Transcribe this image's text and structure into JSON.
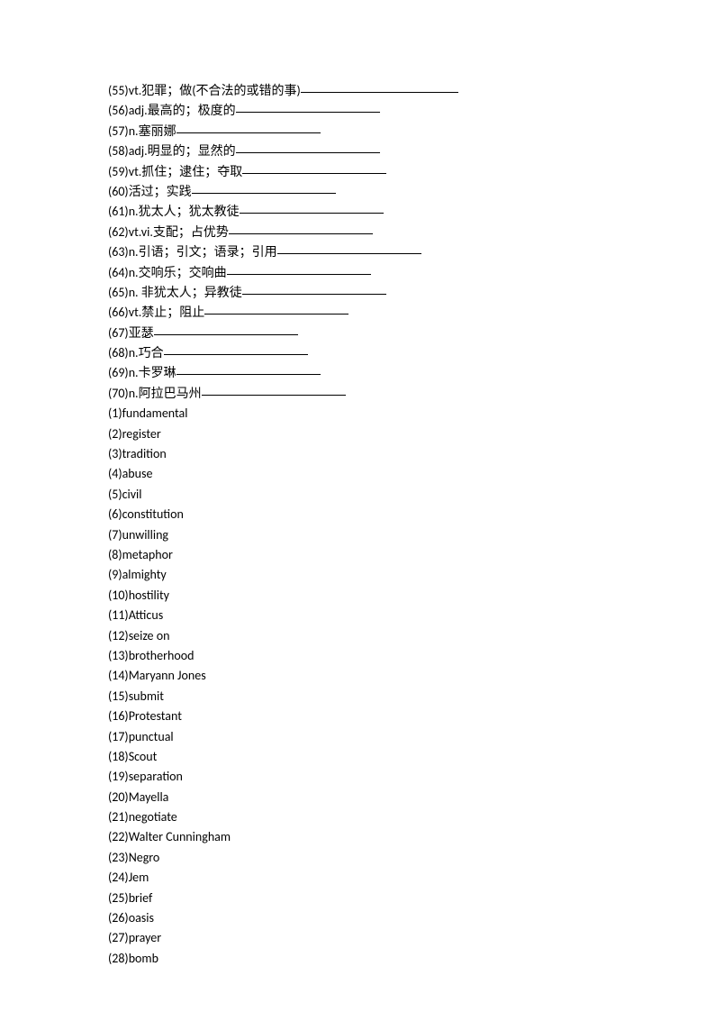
{
  "fill_items": [
    {
      "n": "55",
      "text": "vt.犯罪；做(不合法的或错的事)",
      "blank": "long"
    },
    {
      "n": "56",
      "text": "adj.最高的；极度的",
      "blank": "med"
    },
    {
      "n": "57",
      "text": "n.塞丽娜",
      "blank": "med"
    },
    {
      "n": "58",
      "text": "adj.明显的；显然的",
      "blank": "med"
    },
    {
      "n": "59",
      "text": "vt.抓住；逮住；夺取",
      "blank": "med"
    },
    {
      "n": "60",
      "text": "活过；实践",
      "blank": "med"
    },
    {
      "n": "61",
      "text": "n.犹太人；犹太教徒",
      "blank": "med"
    },
    {
      "n": "62",
      "text": "vt.vi.支配；占优势",
      "blank": "med"
    },
    {
      "n": "63",
      "text": "n.引语；引文；语录；引用",
      "blank": "med"
    },
    {
      "n": "64",
      "text": "n.交响乐；交响曲",
      "blank": "med"
    },
    {
      "n": "65",
      "text": "n. 非犹太人；异教徒",
      "blank": "med"
    },
    {
      "n": "66",
      "text": "vt.禁止；阻止",
      "blank": "med"
    },
    {
      "n": "67",
      "text": "亚瑟",
      "blank": "med"
    },
    {
      "n": "68",
      "text": "n.巧合",
      "blank": "med"
    },
    {
      "n": "69",
      "text": "n.卡罗琳",
      "blank": "med"
    },
    {
      "n": "70",
      "text": "n.阿拉巴马州",
      "blank": "med"
    }
  ],
  "answers": [
    {
      "n": "1",
      "text": "fundamental"
    },
    {
      "n": "2",
      "text": "register"
    },
    {
      "n": "3",
      "text": "tradition"
    },
    {
      "n": "4",
      "text": "abuse"
    },
    {
      "n": "5",
      "text": "civil"
    },
    {
      "n": "6",
      "text": "constitution"
    },
    {
      "n": "7",
      "text": "unwilling"
    },
    {
      "n": "8",
      "text": "metaphor"
    },
    {
      "n": "9",
      "text": "almighty"
    },
    {
      "n": "10",
      "text": "hostility"
    },
    {
      "n": "11",
      "text": "Atticus"
    },
    {
      "n": "12",
      "text": "seize on"
    },
    {
      "n": "13",
      "text": "brotherhood"
    },
    {
      "n": "14",
      "text": "Maryann Jones"
    },
    {
      "n": "15",
      "text": "submit"
    },
    {
      "n": "16",
      "text": "Protestant"
    },
    {
      "n": "17",
      "text": "punctual"
    },
    {
      "n": "18",
      "text": "Scout"
    },
    {
      "n": "19",
      "text": "separation"
    },
    {
      "n": "20",
      "text": "Mayella"
    },
    {
      "n": "21",
      "text": "negotiate"
    },
    {
      "n": "22",
      "text": "Walter Cunningham"
    },
    {
      "n": "23",
      "text": "Negro"
    },
    {
      "n": "24",
      "text": "Jem"
    },
    {
      "n": "25",
      "text": "brief"
    },
    {
      "n": "26",
      "text": "oasis"
    },
    {
      "n": "27",
      "text": "prayer"
    },
    {
      "n": "28",
      "text": "bomb"
    }
  ]
}
